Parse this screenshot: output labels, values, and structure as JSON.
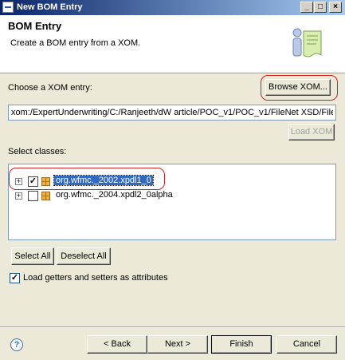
{
  "window": {
    "title": "New BOM Entry",
    "controls": [
      "_",
      "□",
      "×"
    ]
  },
  "banner": {
    "heading": "BOM Entry",
    "description": "Create a BOM entry from a XOM."
  },
  "xom": {
    "label": "Choose a XOM entry:",
    "browse_label": "Browse XOM...",
    "path_value": "xom:/ExpertUnderwriting/C:/Ranjeeth/dW article/POC_v1/POC_v1/FileNet XSD/File",
    "load_label": "Load XOM"
  },
  "classes": {
    "label": "Select classes:",
    "items": [
      {
        "label": "org.wfmc._2002.xpdl1_0",
        "checked": true,
        "selected": true
      },
      {
        "label": "org.wfmc._2004.xpdl2_0alpha",
        "checked": false,
        "selected": false
      }
    ],
    "select_all_label": "Select All",
    "deselect_all_label": "Deselect All"
  },
  "options": {
    "load_getters_label": "Load getters and setters as attributes",
    "load_getters_checked": true
  },
  "footer": {
    "help_symbol": "?",
    "back_label": "< Back",
    "next_label": "Next >",
    "finish_label": "Finish",
    "cancel_label": "Cancel"
  },
  "icons": [
    "app-icon",
    "bom-wizard-icon",
    "package-icon",
    "expand-icon",
    "help-icon"
  ],
  "colors": {
    "title_start": "#0a246a",
    "title_end": "#a6caf0",
    "selection": "#316ac5",
    "annotation": "#d42020",
    "dialog_bg": "#ece9d8"
  }
}
